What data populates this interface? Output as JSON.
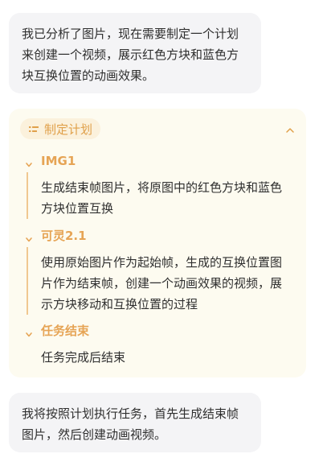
{
  "chat": {
    "top_message": "我已分析了图片，现在需要制定一个计划来创建一个视频，展示红色方块和蓝色方块互换位置的动画效果。",
    "bottom_message": "我将按照计划执行任务，首先生成结束帧图片，然后创建动画视频。"
  },
  "plan": {
    "header_label": "制定计划",
    "header_icon": "plan-list-icon",
    "collapse_icon": "chevron-up-icon",
    "accent_color": "#e6a455",
    "steps": [
      {
        "name": "IMG1",
        "description": "生成结束帧图片，将原图中的红色方块和蓝色方块位置互换"
      },
      {
        "name": "可灵2.1",
        "description": "使用原始图片作为起始帧，生成的互换位置图片作为结束帧，创建一个动画效果的视频，展示方块移动和互换位置的过程"
      },
      {
        "name": "任务结束",
        "description": "任务完成后结束"
      }
    ]
  }
}
